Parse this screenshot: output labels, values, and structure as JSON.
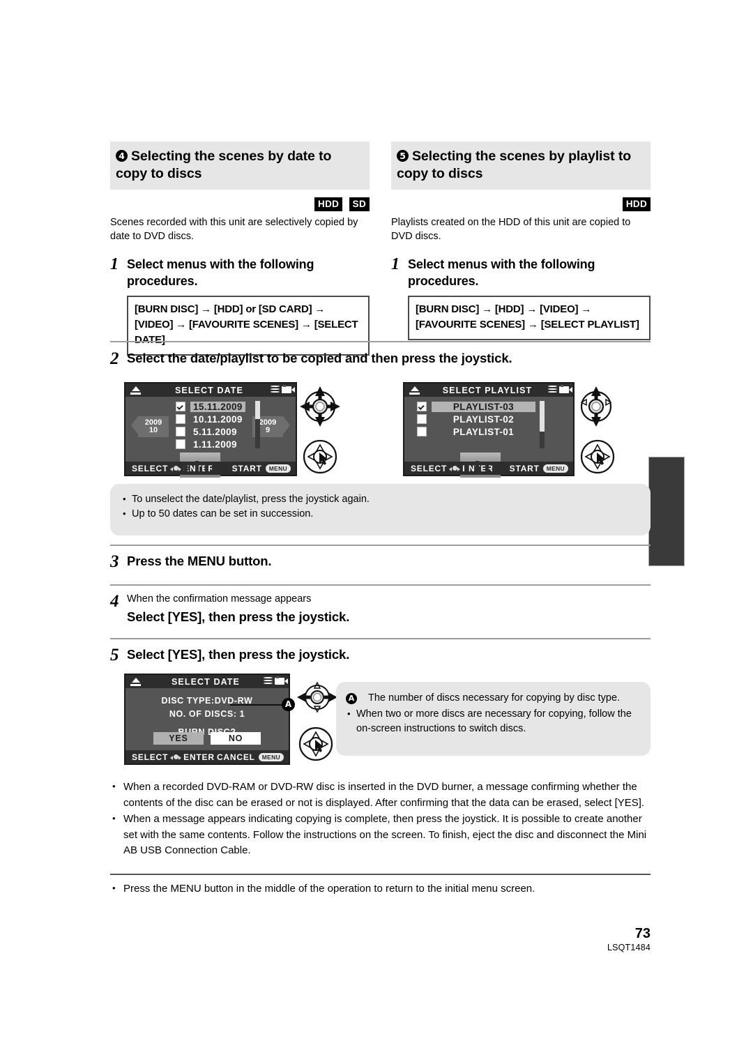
{
  "sections": [
    {
      "number": "4",
      "title": "Selecting the scenes by date to copy to discs",
      "badges": [
        "HDD",
        "SD"
      ],
      "lede": "Scenes recorded with this unit are selectively copied by date to DVD discs.",
      "step1_num": "1",
      "step1_text": "Select menus with the following procedures.",
      "menu_path": "[BURN DISC] → [HDD] or [SD CARD] → [VIDEO] → [FAVOURITE SCENES] → [SELECT DATE]"
    },
    {
      "number": "5",
      "title": "Selecting the scenes by playlist to copy to discs",
      "badges": [
        "HDD"
      ],
      "lede": "Playlists created on the HDD of this unit are copied to DVD discs.",
      "step1_num": "1",
      "step1_text": "Select menus with the following procedures.",
      "menu_path": "[BURN DISC] → [HDD] → [VIDEO] → [FAVOURITE SCENES] → [SELECT PLAYLIST]"
    }
  ],
  "step2": {
    "num": "2",
    "text": "Select the date/playlist to be copied and then press the joystick."
  },
  "lcd_date": {
    "eject_icon": "eject-icon",
    "title": "SELECT DATE",
    "mode_icons": [
      "disc-stack-icon",
      "camcorder-icon"
    ],
    "year_prev": {
      "year": "2009",
      "month": "10"
    },
    "year_next": {
      "year": "2009",
      "month": "9"
    },
    "items": [
      {
        "label": "15.11.2009",
        "checked": true,
        "selected": true
      },
      {
        "label": "10.11.2009",
        "checked": false,
        "selected": false
      },
      {
        "label": "5.11.2009",
        "checked": false,
        "selected": false
      },
      {
        "label": "1.11.2009",
        "checked": false,
        "selected": false
      }
    ],
    "footer_select": "SELECT",
    "footer_enter": "ENTER",
    "footer_start": "START",
    "footer_menu_pill": "MENU"
  },
  "lcd_playlist": {
    "eject_icon": "eject-icon",
    "title": "SELECT PLAYLIST",
    "mode_icons": [
      "disc-stack-icon",
      "camcorder-icon"
    ],
    "items": [
      {
        "label": "PLAYLIST-03",
        "checked": true,
        "selected": true
      },
      {
        "label": "PLAYLIST-02",
        "checked": false,
        "selected": false
      },
      {
        "label": "PLAYLIST-01",
        "checked": false,
        "selected": false
      }
    ],
    "footer_select": "SELECT",
    "footer_enter": "ENTER",
    "footer_start": "START",
    "footer_menu_pill": "MENU"
  },
  "note_top": {
    "bullets": [
      "To unselect the date/playlist, press the joystick again.",
      "Up to 50 dates can be set in succession."
    ]
  },
  "step3": {
    "num": "3",
    "text": "Press the MENU button."
  },
  "step4": {
    "num": "4",
    "sub": "When the confirmation message appears",
    "text": "Select [YES], then press the joystick."
  },
  "step5": {
    "num": "5",
    "text": "Select [YES], then press the joystick."
  },
  "lcd_confirm": {
    "eject_icon": "eject-icon",
    "title": "SELECT DATE",
    "mode_icons": [
      "disc-stack-icon",
      "camcorder-icon"
    ],
    "disc_type": "DISC TYPE:DVD-RW",
    "no_of_discs": "NO. OF DISCS: 1",
    "question": "BURN DISC?",
    "yes": "YES",
    "no": "NO",
    "footer_select": "SELECT",
    "footer_enter": "ENTER",
    "footer_cancel": "CANCEL",
    "footer_menu_pill": "MENU"
  },
  "callout_a": "A",
  "note_bottom": {
    "a_marker": "A",
    "a_text": "The number of discs necessary for copying by disc type.",
    "bullet": "When two or more discs are necessary for copying, follow the on-screen instructions to switch discs."
  },
  "bullets_bottom": [
    "When a recorded DVD-RAM or DVD-RW disc is inserted in the DVD burner, a message confirming whether the contents of the disc can be erased or not is displayed. After confirming that the data can be erased, select [YES].",
    "When a message appears indicating copying is complete, then press the joystick. It is possible to create another set with the same contents. Follow the instructions on the screen. To finish, eject the disc and disconnect the Mini AB USB Connection Cable."
  ],
  "bullet_final": "Press the MENU button in the middle of the operation to return to the initial menu screen.",
  "footer": {
    "page_number": "73",
    "doc_code": "LSQT1484"
  },
  "colors": {
    "heading_bg": "#e6e6e6",
    "note_bg": "#e6e6e6",
    "badge_bg": "#000000",
    "rule": "#9c9c9c",
    "tab_mark": "#3a3a3a"
  }
}
